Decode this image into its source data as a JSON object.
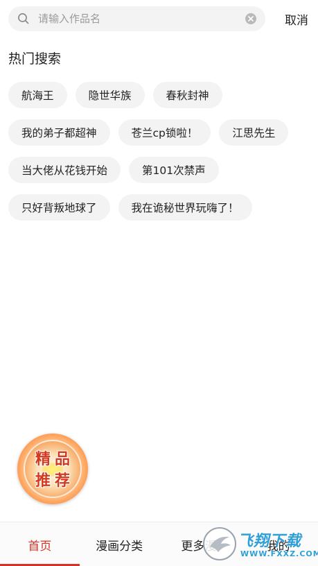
{
  "search": {
    "placeholder": "请输入作品名",
    "cancel_label": "取消"
  },
  "hot": {
    "title": "热门搜索",
    "tags": [
      "航海王",
      "隐世华族",
      "春秋封神",
      "我的弟子都超神",
      "苍兰cp锁啦！",
      "江思先生",
      "当大佬从花钱开始",
      "第101次禁声",
      "只好背叛地球了",
      "我在诡秘世界玩嗨了！"
    ]
  },
  "promo": {
    "line1": "精品",
    "line2": "推荐"
  },
  "nav": {
    "items": [
      {
        "label": "首页",
        "active": true
      },
      {
        "label": "漫画分类",
        "active": false
      },
      {
        "label": "更多漫",
        "active": false
      },
      {
        "label": "我的",
        "active": false
      }
    ],
    "active_color": "#d93025"
  },
  "watermark": {
    "brand": "飞翔下载",
    "url": "WWW.FXXZ.COM"
  }
}
